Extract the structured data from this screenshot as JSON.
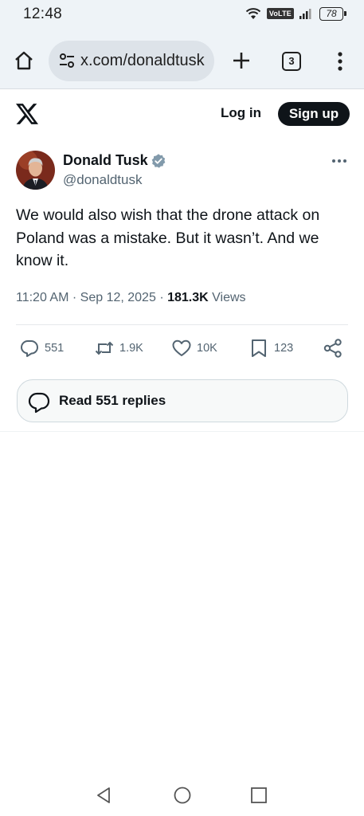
{
  "status_bar": {
    "time": "12:48",
    "network_badge": "VoLTE",
    "battery_level": "78"
  },
  "browser": {
    "url": "x.com/donaldtusk",
    "tab_count": "3",
    "icons": [
      "home-icon",
      "tune-icon",
      "plus-icon",
      "tabs-icon",
      "more-vert-icon"
    ]
  },
  "header": {
    "login_label": "Log in",
    "signup_label": "Sign up"
  },
  "post": {
    "author_name": "Donald Tusk",
    "author_handle": "@donaldtusk",
    "text": "We would also wish that the drone attack on Poland was a mistake. But it wasn’t. And we know it.",
    "time": "11:20 AM",
    "date": "Sep 12, 2025",
    "views_count": "181.3K",
    "views_label": "Views",
    "stats": {
      "replies": "551",
      "reposts": "1.9K",
      "likes": "10K",
      "bookmarks": "123"
    },
    "read_replies_label": "Read 551 replies"
  },
  "colors": {
    "text_primary": "#0f1419",
    "text_secondary": "#536471",
    "verified": "#829aab",
    "chrome_bg": "#eef3f7"
  }
}
